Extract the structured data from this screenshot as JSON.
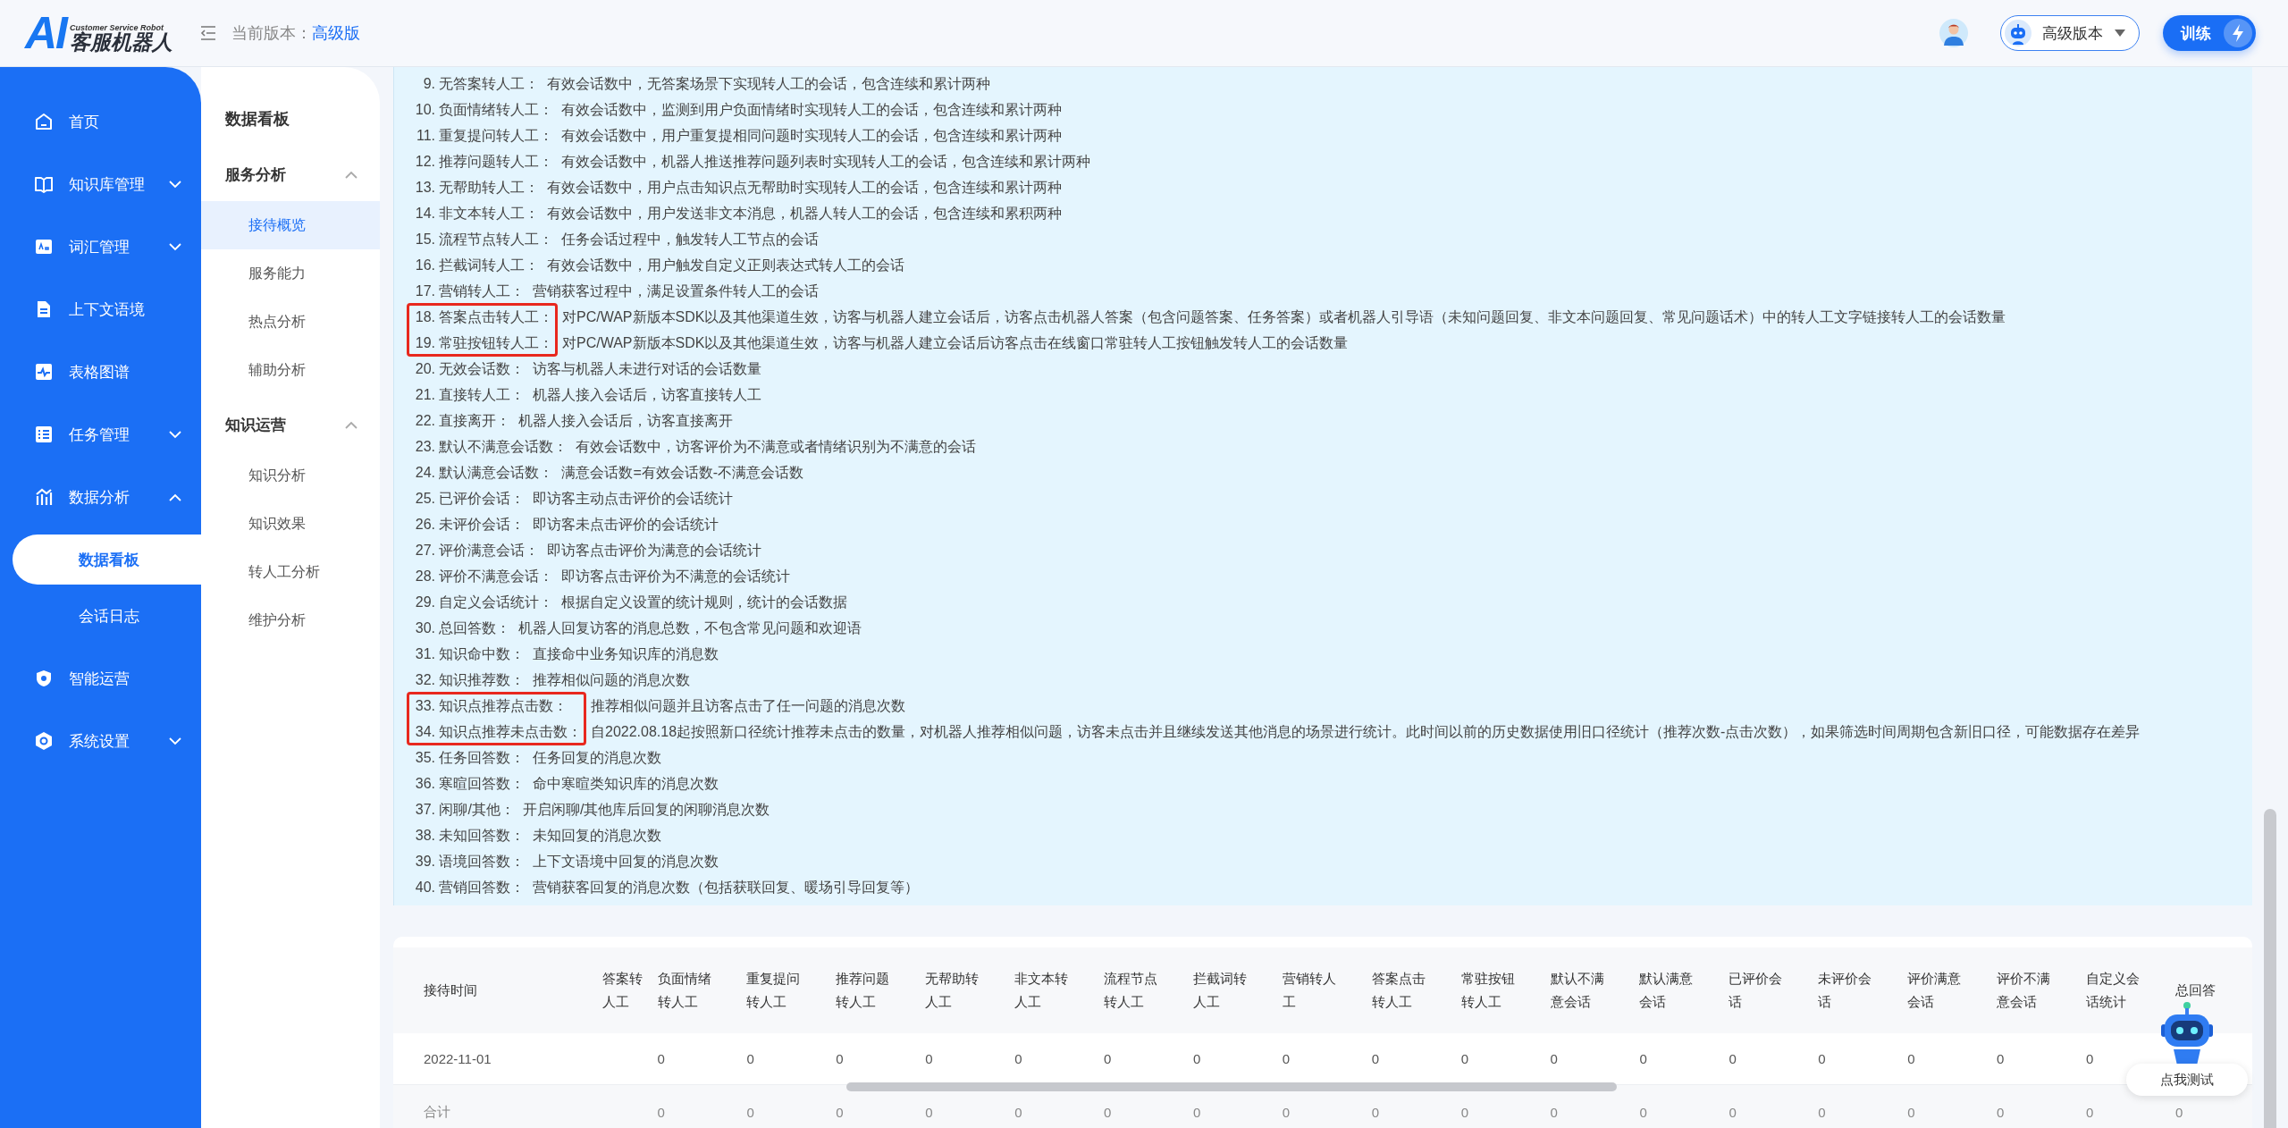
{
  "header": {
    "logo": {
      "mark": "AI",
      "tagline": "Customer Service Robot",
      "name": "客服机器人"
    },
    "version_label": "当前版本：",
    "version_value": "高级版",
    "version_select": {
      "value": "高级版本"
    },
    "train_button": "训练"
  },
  "sidebar": {
    "items": [
      {
        "label": "首页",
        "kind": "link"
      },
      {
        "label": "知识库管理",
        "kind": "group",
        "expanded": false
      },
      {
        "label": "词汇管理",
        "kind": "group",
        "expanded": false
      },
      {
        "label": "上下文语境",
        "kind": "link"
      },
      {
        "label": "表格图谱",
        "kind": "link"
      },
      {
        "label": "任务管理",
        "kind": "group",
        "expanded": false
      },
      {
        "label": "数据分析",
        "kind": "group",
        "expanded": true,
        "children": [
          {
            "label": "数据看板",
            "selected": true
          },
          {
            "label": "会话日志",
            "selected": false
          }
        ]
      },
      {
        "label": "智能运营",
        "kind": "link"
      },
      {
        "label": "系统设置",
        "kind": "group",
        "expanded": false
      }
    ]
  },
  "subnav": {
    "title": "数据看板",
    "groups": [
      {
        "label": "服务分析",
        "expanded": true,
        "items": [
          {
            "label": "接待概览",
            "selected": true
          },
          {
            "label": "服务能力",
            "selected": false
          },
          {
            "label": "热点分析",
            "selected": false
          },
          {
            "label": "辅助分析",
            "selected": false
          }
        ]
      },
      {
        "label": "知识运营",
        "expanded": true,
        "items": [
          {
            "label": "知识分析",
            "selected": false
          },
          {
            "label": "知识效果",
            "selected": false
          },
          {
            "label": "转人工分析",
            "selected": false
          },
          {
            "label": "维护分析",
            "selected": false
          }
        ]
      }
    ]
  },
  "notes": [
    {
      "number": "9.",
      "term": "无答案转人工：",
      "desc": "有效会话数中，无答案场景下实现转人工的会话，包含连续和累计两种",
      "highlighted": false
    },
    {
      "number": "10.",
      "term": "负面情绪转人工：",
      "desc": "有效会话数中，监测到用户负面情绪时实现转人工的会话，包含连续和累计两种",
      "highlighted": false
    },
    {
      "number": "11.",
      "term": "重复提问转人工：",
      "desc": "有效会话数中，用户重复提相同问题时实现转人工的会话，包含连续和累计两种",
      "highlighted": false
    },
    {
      "number": "12.",
      "term": "推荐问题转人工：",
      "desc": "有效会话数中，机器人推送推荐问题列表时实现转人工的会话，包含连续和累计两种",
      "highlighted": false
    },
    {
      "number": "13.",
      "term": "无帮助转人工：",
      "desc": "有效会话数中，用户点击知识点无帮助时实现转人工的会话，包含连续和累计两种",
      "highlighted": false
    },
    {
      "number": "14.",
      "term": "非文本转人工：",
      "desc": "有效会话数中，用户发送非文本消息，机器人转人工的会话，包含连续和累积两种",
      "highlighted": false
    },
    {
      "number": "15.",
      "term": "流程节点转人工：",
      "desc": "任务会话过程中，触发转人工节点的会话",
      "highlighted": false
    },
    {
      "number": "16.",
      "term": "拦截词转人工：",
      "desc": "有效会话数中，用户触发自定义正则表达式转人工的会话",
      "highlighted": false
    },
    {
      "number": "17.",
      "term": "营销转人工：",
      "desc": "营销获客过程中，满足设置条件转人工的会话",
      "highlighted": false
    },
    {
      "number": "18.",
      "term": "答案点击转人工：",
      "desc": "对PC/WAP新版本SDK以及其他渠道生效，访客与机器人建立会话后，访客点击机器人答案（包含问题答案、任务答案）或者机器人引导语（未知问题回复、非文本问题回复、常见问题话术）中的转人工文字链接转人工的会话数量",
      "highlighted": true
    },
    {
      "number": "19.",
      "term": "常驻按钮转人工：",
      "desc": "对PC/WAP新版本SDK以及其他渠道生效，访客与机器人建立会话后访客点击在线窗口常驻转人工按钮触发转人工的会话数量",
      "highlighted": true
    },
    {
      "number": "20.",
      "term": "无效会话数：",
      "desc": "访客与机器人未进行对话的会话数量",
      "highlighted": false
    },
    {
      "number": "21.",
      "term": "直接转人工：",
      "desc": "机器人接入会话后，访客直接转人工",
      "highlighted": false
    },
    {
      "number": "22.",
      "term": "直接离开：",
      "desc": "机器人接入会话后，访客直接离开",
      "highlighted": false
    },
    {
      "number": "23.",
      "term": "默认不满意会话数：",
      "desc": "有效会话数中，访客评价为不满意或者情绪识别为不满意的会话",
      "highlighted": false
    },
    {
      "number": "24.",
      "term": "默认满意会话数：",
      "desc": "满意会话数=有效会话数-不满意会话数",
      "highlighted": false
    },
    {
      "number": "25.",
      "term": "已评价会话：",
      "desc": "即访客主动点击评价的会话统计",
      "highlighted": false
    },
    {
      "number": "26.",
      "term": "未评价会话：",
      "desc": "即访客未点击评价的会话统计",
      "highlighted": false
    },
    {
      "number": "27.",
      "term": "评价满意会话：",
      "desc": "即访客点击评价为满意的会话统计",
      "highlighted": false
    },
    {
      "number": "28.",
      "term": "评价不满意会话：",
      "desc": "即访客点击评价为不满意的会话统计",
      "highlighted": false
    },
    {
      "number": "29.",
      "term": "自定义会话统计：",
      "desc": "根据自定义设置的统计规则，统计的会话数据",
      "highlighted": false
    },
    {
      "number": "30.",
      "term": "总回答数：",
      "desc": "机器人回复访客的消息总数，不包含常见问题和欢迎语",
      "highlighted": false
    },
    {
      "number": "31.",
      "term": "知识命中数：",
      "desc": "直接命中业务知识库的消息数",
      "highlighted": false
    },
    {
      "number": "32.",
      "term": "知识推荐数：",
      "desc": "推荐相似问题的消息次数",
      "highlighted": false
    },
    {
      "number": "33.",
      "term": "知识点推荐点击数：",
      "desc": "推荐相似问题并且访客点击了任一问题的消息次数",
      "highlighted": true
    },
    {
      "number": "34.",
      "term": "知识点推荐未点击数：",
      "desc": "自2022.08.18起按照新口径统计推荐未点击的数量，对机器人推荐相似问题，访客未点击并且继续发送其他消息的场景进行统计。此时间以前的历史数据使用旧口径统计（推荐次数-点击次数），如果筛选时间周期包含新旧口径，可能数据存在差异",
      "highlighted": true
    },
    {
      "number": "35.",
      "term": "任务回答数：",
      "desc": "任务回复的消息次数",
      "highlighted": false
    },
    {
      "number": "36.",
      "term": "寒暄回答数：",
      "desc": "命中寒暄类知识库的消息次数",
      "highlighted": false
    },
    {
      "number": "37.",
      "term": "闲聊/其他：",
      "desc": "开启闲聊/其他库后回复的闲聊消息次数",
      "highlighted": false
    },
    {
      "number": "38.",
      "term": "未知回答数：",
      "desc": "未知回复的消息次数",
      "highlighted": false
    },
    {
      "number": "39.",
      "term": "语境回答数：",
      "desc": "上下文语境中回复的消息次数",
      "highlighted": false
    },
    {
      "number": "40.",
      "term": "营销回答数：",
      "desc": "营销获客回复的消息次数（包括获联回复、暖场引导回复等）",
      "highlighted": false
    }
  ],
  "table": {
    "time_header": "接待时间",
    "partial_header": "答案转人工",
    "columns": [
      "负面情绪转人工",
      "重复提问转人工",
      "推荐问题转人工",
      "无帮助转人工",
      "非文本转人工",
      "流程节点转人工",
      "拦截词转人工",
      "营销转人工",
      "答案点击转人工",
      "常驻按钮转人工",
      "默认不满意会话",
      "默认满意会话",
      "已评价会话",
      "未评价会话",
      "评价满意会话",
      "评价不满意会话",
      "自定义会话统计",
      "总回答"
    ],
    "rows": [
      {
        "label": "2022-11-01",
        "values": [
          "0",
          "0",
          "0",
          "0",
          "0",
          "0",
          "0",
          "0",
          "0",
          "0",
          "0",
          "0",
          "0",
          "0",
          "0",
          "0",
          "0"
        ]
      },
      {
        "label": "合计",
        "values": [
          "0",
          "0",
          "0",
          "0",
          "0",
          "0",
          "0",
          "0",
          "0",
          "0",
          "0",
          "0",
          "0",
          "0",
          "0",
          "0",
          "0",
          "0"
        ]
      }
    ]
  },
  "test_widget": {
    "label": "点我测试"
  }
}
